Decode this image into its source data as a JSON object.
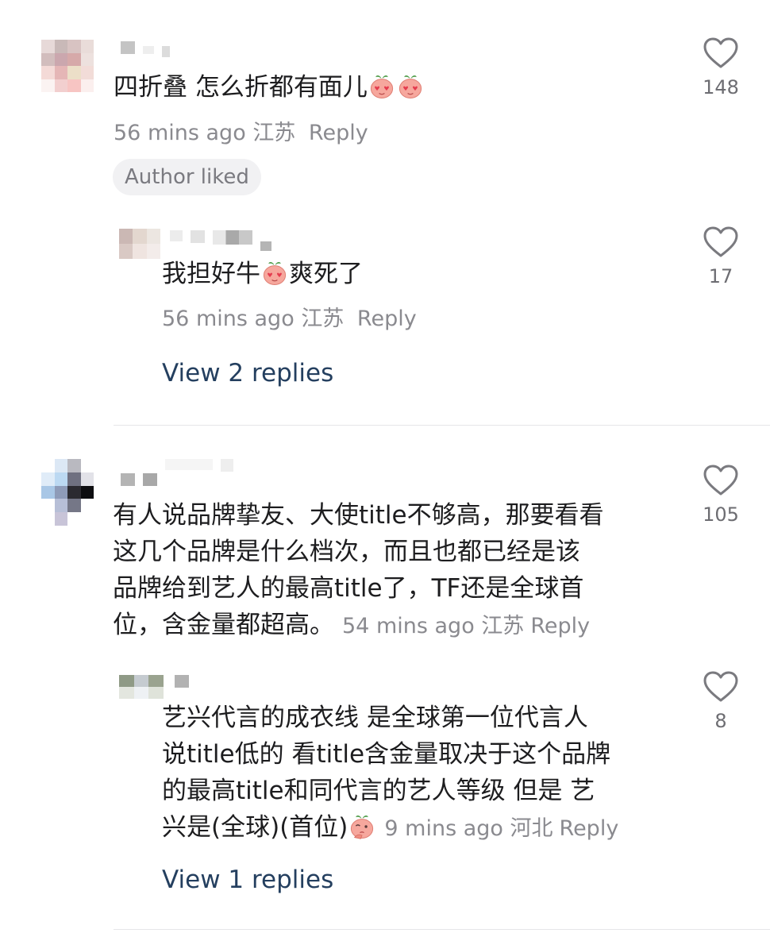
{
  "comments": [
    {
      "text": "四折叠 怎么折都有面儿",
      "emoji": [
        "heart-eyes-peach-emoji",
        "heart-eyes-peach-emoji"
      ],
      "time": "56 mins ago",
      "location": "江苏",
      "reply_label": "Reply",
      "author_liked_label": "Author liked",
      "likes": "148",
      "replies": [
        {
          "text_before": "我担好牛",
          "emoji": "heart-eyes-peach-emoji",
          "text_after": "爽死了",
          "time": "56 mins ago",
          "location": "江苏",
          "reply_label": "Reply",
          "likes": "17"
        }
      ],
      "view_replies_label": "View 2 replies"
    },
    {
      "lines": [
        "有人说品牌挚友、大使title不够高，那要看看",
        "这几个品牌是什么档次，而且也都已经是该",
        "品牌给到艺人的最高title了，TF还是全球首",
        "位，含金量都超高。"
      ],
      "time": "54 mins ago",
      "location": "江苏",
      "reply_label": "Reply",
      "likes": "105",
      "replies": [
        {
          "lines": [
            "艺兴代言的成衣线 是全球第一位代言人",
            "说title低的 看title含金量取决于这个品牌",
            "的最高title和同代言的艺人等级 但是 艺",
            "兴是(全球)(首位)"
          ],
          "emoji": "thinking-peach-emoji",
          "time": "9 mins ago",
          "location": "河北",
          "reply_label": "Reply",
          "likes": "8"
        }
      ],
      "view_replies_label": "View 1 replies"
    }
  ],
  "icons": {
    "like": "heart-outline-icon"
  },
  "colors": {
    "text": "#1d1d1f",
    "meta": "#8a8a8f",
    "link": "#243f5f",
    "badge_bg": "#f1f1f3",
    "divider": "#e6e6e8"
  }
}
